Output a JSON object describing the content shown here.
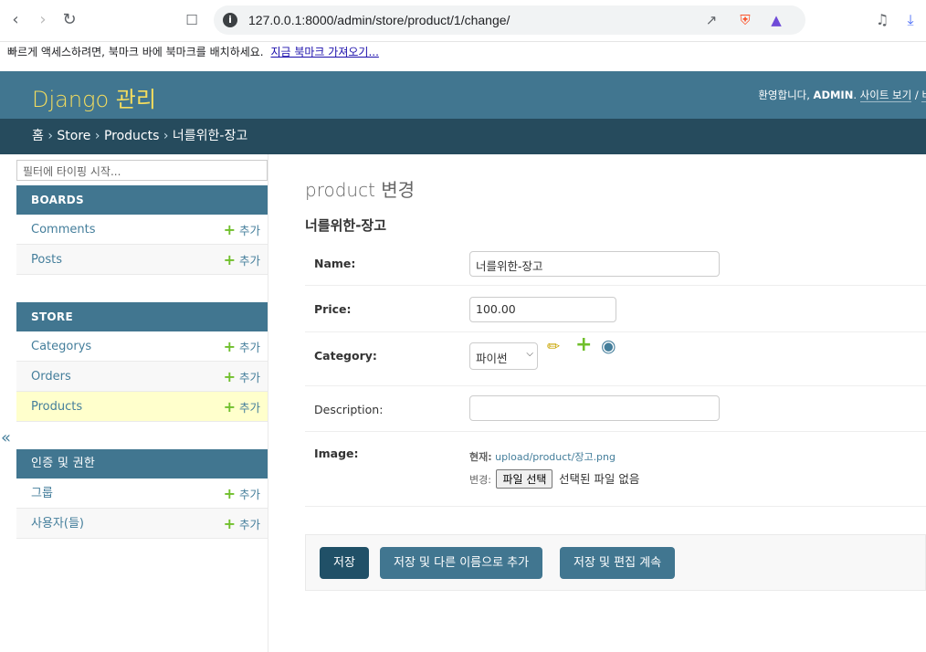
{
  "browser": {
    "url": "127.0.0.1:8000/admin/store/product/1/change/",
    "bookmarks_text": "빠르게 액세스하려면, 북마크 바에 북마크를 배치하세요.",
    "bookmarks_link": "지금 북마크 가져오기..."
  },
  "header": {
    "brand": "Django 관리",
    "welcome": "환영합니다,",
    "username": "ADMIN",
    "view_site": "사이트 보기",
    "separator": "/",
    "truncated_link": "비"
  },
  "breadcrumbs": {
    "home": "홈",
    "sep": "›",
    "app": "Store",
    "model": "Products",
    "object": "너를위한-장고"
  },
  "sidebar": {
    "filter_placeholder": "필터에 타이핑 시작...",
    "add_label": "추가",
    "collapse_glyph": "«",
    "apps": [
      {
        "caption": "BOARDS",
        "models": [
          "Comments",
          "Posts"
        ]
      },
      {
        "caption": "STORE",
        "models": [
          "Categorys",
          "Orders",
          "Products"
        ]
      },
      {
        "caption": "인증 및 권한",
        "models": [
          "그룹",
          "사용자(들)"
        ]
      }
    ]
  },
  "main": {
    "page_title": "product 변경",
    "object_title": "너를위한-장고",
    "fields": {
      "name": {
        "label": "Name:",
        "value": "너를위한-장고"
      },
      "price": {
        "label": "Price:",
        "value": "100.00"
      },
      "category": {
        "label": "Category:",
        "value": "파이썬"
      },
      "description": {
        "label": "Description:",
        "value": ""
      },
      "image": {
        "label": "Image:",
        "current_label": "현재:",
        "current_file": "upload/product/장고.png",
        "change_label": "변경:",
        "file_button": "파일 선택",
        "no_file": "선택된 파일 없음"
      }
    },
    "buttons": {
      "save": "저장",
      "save_as_new": "저장 및 다른 이름으로 추가",
      "save_continue": "저장 및 편집 계속"
    }
  },
  "colors": {
    "header": "#417690",
    "breadcrumbs": "#264b5d",
    "brand": "#f5dd5d",
    "link": "#447e9b",
    "add_plus": "#70bf2b",
    "current_row": "#ffffcc",
    "default_button": "#205067"
  }
}
